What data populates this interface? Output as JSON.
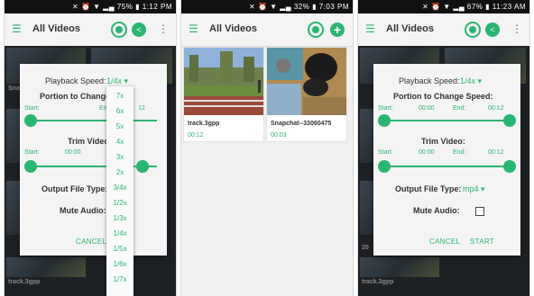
{
  "status_bar": {
    "phone1": {
      "battery": "75%",
      "time": "1:12 PM"
    },
    "phone2": {
      "battery": "32%",
      "time": "7:03 PM"
    },
    "phone3": {
      "battery": "67%",
      "time": "11:23 AM"
    }
  },
  "app": {
    "title": "All Videos"
  },
  "dialog": {
    "playback_label": "Playback Speed:",
    "playback_value_p1": "1/4x",
    "playback_value_p3": "1/4x",
    "portion_label": "Portion to Change Speed:",
    "portion_label_short": "Portion to Change",
    "start_label": "Start:",
    "start_time": "00:00",
    "end_label": "End:",
    "end_time": "00:12",
    "trim_label": "Trim Video:",
    "trim_label_short": "Trim Video",
    "output_label": "Output File Type:",
    "output_value": "mp4",
    "mute_label": "Mute Audio:",
    "cancel": "CANCEL",
    "start_button": "START"
  },
  "speed_options": [
    "7x",
    "6x",
    "5x",
    "4x",
    "3x",
    "2x",
    "3/4x",
    "1/2x",
    "1/3x",
    "1/4x",
    "1/5x",
    "1/6x",
    "1/7x"
  ],
  "videos": [
    {
      "name": "track.3gpp",
      "duration": "00:12"
    },
    {
      "name": "Snapchat--33060475",
      "duration": "00:03"
    }
  ],
  "background_labels": {
    "snap": "Snapc",
    "track": "track.3gpp",
    "num": "20"
  }
}
